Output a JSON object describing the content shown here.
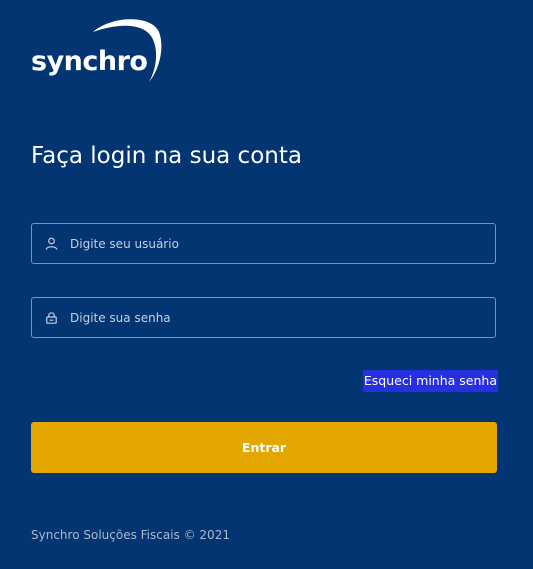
{
  "brand": {
    "logo_text": "synchro"
  },
  "login": {
    "title": "Faça login na sua conta",
    "username": {
      "value": "",
      "placeholder": "Digite seu usuário",
      "icon": "user-icon"
    },
    "password": {
      "value": "",
      "placeholder": "Digite sua senha",
      "icon": "lock-icon"
    },
    "forgot_link": "Esqueci minha senha",
    "submit_label": "Entrar"
  },
  "footer": {
    "copyright": "Synchro Soluções Fiscais © 2021"
  },
  "colors": {
    "background": "#023571",
    "primary_button": "#e3a700",
    "field_border": "#7c93b4",
    "link_highlight": "#2730e0"
  }
}
